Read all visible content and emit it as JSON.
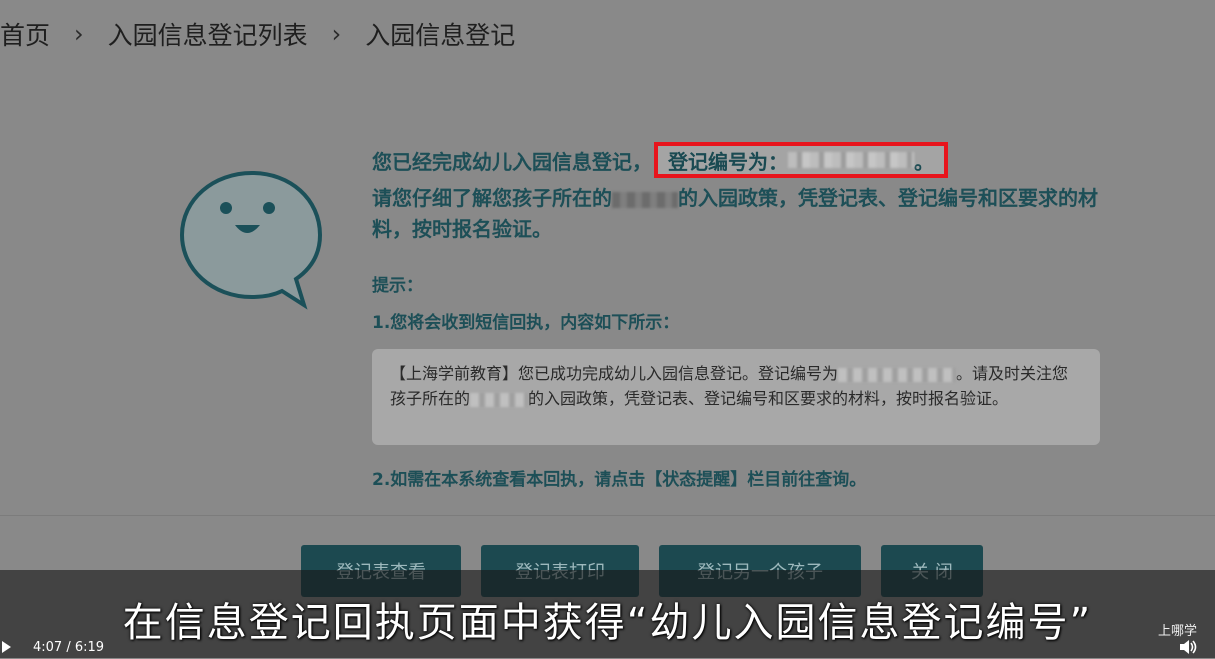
{
  "breadcrumb": {
    "items": [
      "首页",
      "入园信息登记列表",
      "入园信息登记"
    ],
    "separator": "›"
  },
  "message": {
    "line1_prefix": "您已经完成幼儿入园信息登记，",
    "reg_label": "登记编号为：",
    "reg_suffix": "。",
    "line2_part1": "请您仔细了解您孩子所在的",
    "line2_part2": "的入园政策，凭登记表、登记编号和区要求的材料，按时报名验证。"
  },
  "tips": {
    "title": "提示：",
    "tip1": "1.您将会收到短信回执，内容如下所示：",
    "sms_part1": "【上海学前教育】您已成功完成幼儿入园信息登记。登记编号为",
    "sms_part2": "。请及时关注您孩子所在的",
    "sms_part3": "的入园政策，凭登记表、登记编号和区要求的材料，按时报名验证。",
    "tip2": "2.如需在本系统查看本回执，请点击【状态提醒】栏目前往查询。"
  },
  "buttons": {
    "view": "登记表查看",
    "print": "登记表打印",
    "another": "登记另一个孩子",
    "close": "关 闭"
  },
  "video": {
    "subtitle": "在信息登记回执页面中获得“幼儿入园信息登记编号”",
    "watermark": "上哪学",
    "time": "4:07 / 6:19"
  },
  "colors": {
    "accent_text": "#1d4f57",
    "highlight_border": "#e8141c",
    "button_bg": "#1c4950"
  }
}
